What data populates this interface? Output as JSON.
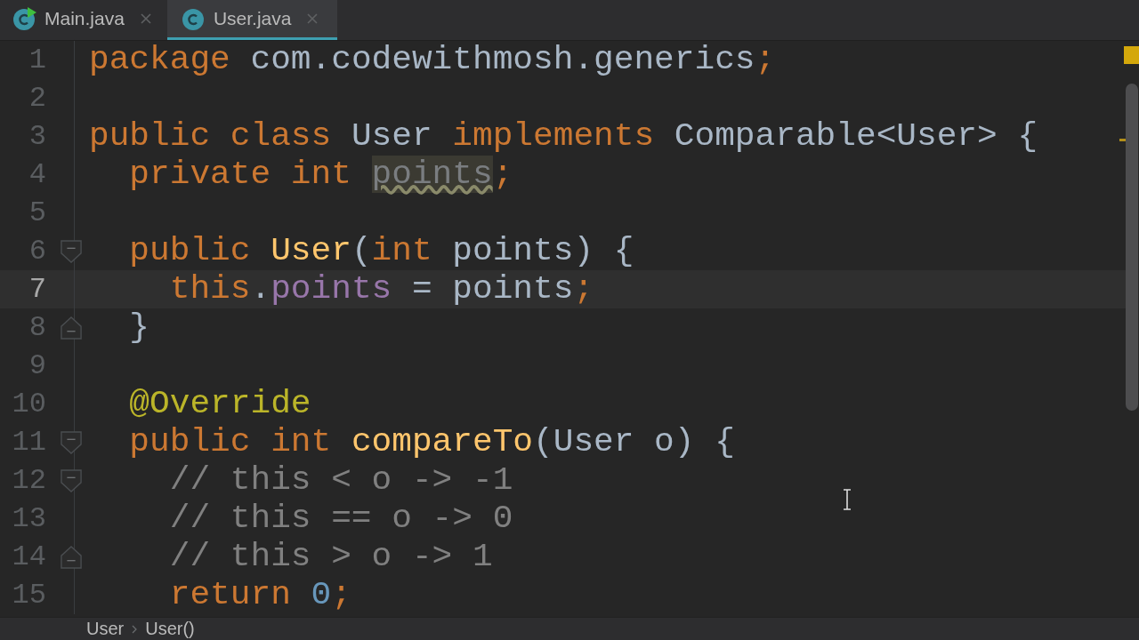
{
  "tabs": [
    {
      "label": "Main.java",
      "kind": "runnable-class",
      "selected": false
    },
    {
      "label": "User.java",
      "kind": "class",
      "selected": true
    }
  ],
  "editor": {
    "lines": [
      {
        "number": "1",
        "current": false,
        "tokens": [
          {
            "kind": "keyword",
            "text": "package "
          },
          {
            "kind": "plain",
            "text": "com.codewithmosh.generics"
          },
          {
            "kind": "keyword",
            "text": ";"
          }
        ]
      },
      {
        "number": "2",
        "current": false,
        "kind": "plain"
      },
      {
        "number": "3",
        "current": false,
        "tokens": [
          {
            "kind": "keyword",
            "text": "public class "
          },
          {
            "kind": "plain",
            "text": "User "
          },
          {
            "kind": "keyword",
            "text": "implements "
          },
          {
            "kind": "plain",
            "text": "Comparable<User> {"
          }
        ]
      },
      {
        "number": "4",
        "current": false,
        "tokens": [
          {
            "kind": "keyword",
            "text": "  private int "
          },
          {
            "kind": "unused-field",
            "text": "points"
          },
          {
            "kind": "keyword",
            "text": ";"
          }
        ]
      },
      {
        "number": "5",
        "current": false,
        "kind": "plain"
      },
      {
        "number": "6",
        "current": false,
        "kind": "fold-start",
        "tokens": [
          {
            "kind": "keyword",
            "text": "  public "
          },
          {
            "kind": "method",
            "text": "User"
          },
          {
            "kind": "plain",
            "text": "("
          },
          {
            "kind": "keyword",
            "text": "int "
          },
          {
            "kind": "plain",
            "text": "points) {"
          }
        ]
      },
      {
        "number": "7",
        "current": true,
        "tokens": [
          {
            "kind": "keyword",
            "text": "    this"
          },
          {
            "kind": "plain",
            "text": "."
          },
          {
            "kind": "field",
            "text": "points"
          },
          {
            "kind": "plain",
            "text": " = points"
          },
          {
            "kind": "keyword",
            "text": ";"
          }
        ]
      },
      {
        "number": "8",
        "current": false,
        "kind": "fold-end",
        "tokens": [
          {
            "kind": "plain",
            "text": "  }"
          }
        ]
      },
      {
        "number": "9",
        "current": false,
        "kind": "plain"
      },
      {
        "number": "10",
        "current": false,
        "tokens": [
          {
            "kind": "annotation",
            "text": "  @Override"
          }
        ]
      },
      {
        "number": "11",
        "current": false,
        "kind": "fold-start",
        "tokens": [
          {
            "kind": "keyword",
            "text": "  public int "
          },
          {
            "kind": "method",
            "text": "compareTo"
          },
          {
            "kind": "plain",
            "text": "(User o) {"
          }
        ]
      },
      {
        "number": "12",
        "current": false,
        "kind": "fold-start",
        "tokens": [
          {
            "kind": "comment",
            "text": "    // this < o -> -1"
          }
        ]
      },
      {
        "number": "13",
        "current": false,
        "tokens": [
          {
            "kind": "comment",
            "text": "    // this == o -> 0"
          }
        ]
      },
      {
        "number": "14",
        "current": false,
        "kind": "fold-end",
        "tokens": [
          {
            "kind": "comment",
            "text": "    // this > o -> 1"
          }
        ]
      },
      {
        "number": "15",
        "current": false,
        "tokens": [
          {
            "kind": "keyword",
            "text": "    return "
          },
          {
            "kind": "number",
            "text": "0"
          },
          {
            "kind": "keyword",
            "text": ";"
          }
        ]
      }
    ]
  },
  "breadcrumbs": [
    "User",
    "User()"
  ]
}
